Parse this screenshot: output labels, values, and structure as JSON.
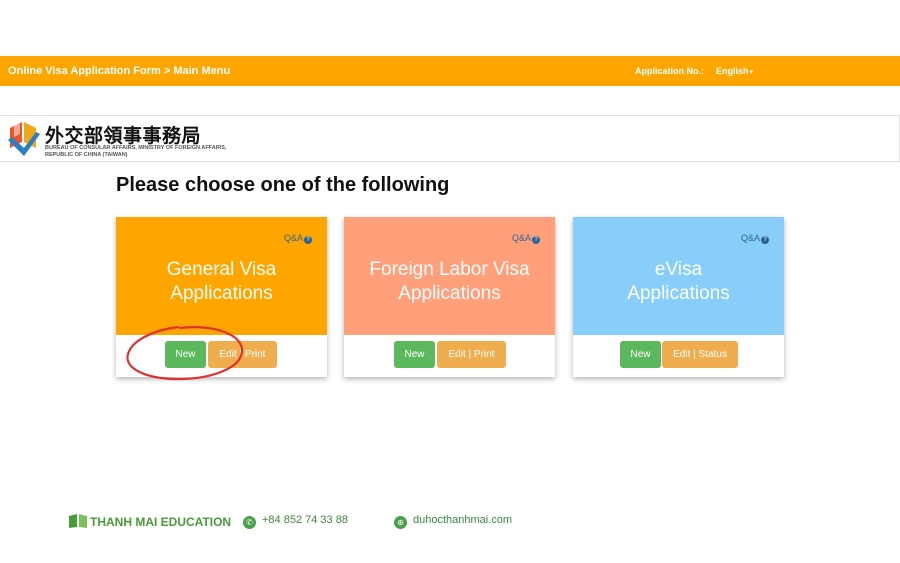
{
  "header": {
    "breadcrumb": "Online Visa Application Form > Main Menu",
    "application_no_label": "Application No.:",
    "language": "English"
  },
  "logo": {
    "chinese_name": "外交部領事事務局",
    "english_name": "BUREAU OF CONSULAR AFFAIRS, MINISTRY OF FOREIGN AFFAIRS, REPUBLIC OF CHINA (TAIWAN)"
  },
  "main": {
    "heading": "Please choose one of the following",
    "cards": [
      {
        "qa_label": "Q&A",
        "title_line1": "General Visa",
        "title_line2": "Applications",
        "color": "#ffa500",
        "buttons": [
          "New",
          "Edit | Print"
        ]
      },
      {
        "qa_label": "Q&A",
        "title_line1": "Foreign Labor Visa",
        "title_line2": "Applications",
        "color": "#ffa07a",
        "buttons": [
          "New",
          "Edit | Print"
        ]
      },
      {
        "qa_label": "Q&A",
        "title_line1": "eVisa",
        "title_line2": "Applications",
        "color": "#87cefa",
        "buttons": [
          "New",
          "Edit | Status"
        ]
      }
    ]
  },
  "footer": {
    "brand": "THANH MAI EDUCATION",
    "phone": "+84 852 74 33 88",
    "website": "duhocthanhmai.com"
  },
  "colors": {
    "topbar": "#ffa500",
    "new_button": "#5cb85c",
    "edit_button": "#f0ad4e",
    "annotation_circle": "#e03030"
  }
}
